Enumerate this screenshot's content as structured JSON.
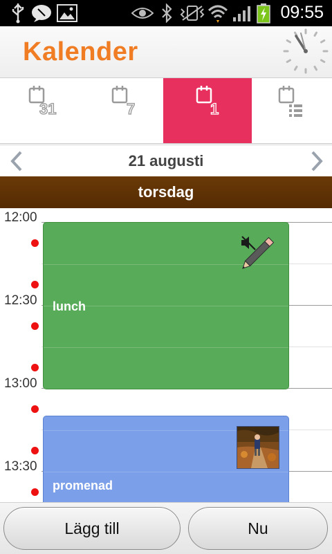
{
  "status_bar": {
    "time": "09:55",
    "icons": [
      "usb-icon",
      "chat-icon",
      "gallery-icon",
      "eye-icon",
      "bluetooth-icon",
      "vibrate-icon",
      "wifi-icon",
      "signal-icon",
      "battery-icon"
    ],
    "battery_color": "#7cc61c"
  },
  "header": {
    "title": "Kalender",
    "title_color": "#f07d24",
    "clock_icon": "clock-icon"
  },
  "tabs": [
    {
      "label": "31",
      "icon": "month-view-icon",
      "active": false
    },
    {
      "label": "7",
      "icon": "week-view-icon",
      "active": false
    },
    {
      "label": "1",
      "icon": "day-view-icon",
      "active": true
    },
    {
      "label": "",
      "icon": "agenda-view-icon",
      "active": false
    }
  ],
  "active_tab_color": "#e8305e",
  "date_nav": {
    "date": "21 augusti",
    "prev_icon": "chevron-left-icon",
    "next_icon": "chevron-right-icon"
  },
  "day": {
    "weekday": "torsdag",
    "bar_color": "#5f3205"
  },
  "timeline": {
    "labels": [
      "12:00",
      "12:30",
      "13:00",
      "13:30"
    ]
  },
  "events": [
    {
      "title": "lunch",
      "color": "#58ab58",
      "icons": [
        "mute-icon",
        "pencil-icon"
      ]
    },
    {
      "title": "promenad",
      "color": "#7b9fe8",
      "icons": [
        "photo-thumbnail"
      ]
    }
  ],
  "reminder_color": "#ee1111",
  "buttons": {
    "add": "Lägg till",
    "now": "Nu"
  }
}
